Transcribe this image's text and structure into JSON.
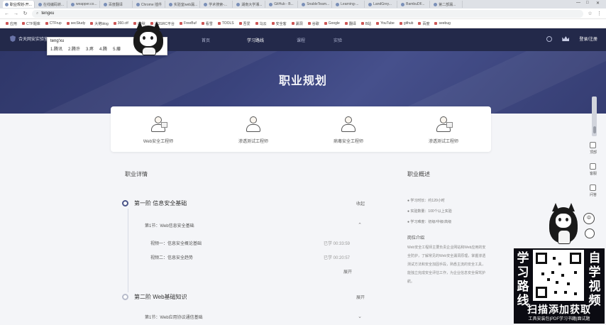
{
  "browser": {
    "tabs": [
      {
        "title": "职业规划-开...",
        "active": true
      },
      {
        "title": "在线编码转..."
      },
      {
        "title": "weapper.co..."
      },
      {
        "title": "百度翻译"
      },
      {
        "title": "Chrome 插件"
      },
      {
        "title": "实验室web漏..."
      },
      {
        "title": "学术搜索-..."
      },
      {
        "title": "湖南大学湘..."
      },
      {
        "title": "GitHub - B..."
      },
      {
        "title": "SnableTeam..."
      },
      {
        "title": "Learning-..."
      },
      {
        "title": "LandGrey..."
      },
      {
        "title": "BambuDF..."
      },
      {
        "title": "第二部漏..."
      }
    ],
    "address": "tengxu",
    "bookmarks": [
      "应用",
      "CTF题库",
      "CTFrup",
      "secStudy",
      "大佬blog",
      "360.ctf",
      "i春秋",
      "X 3SRC平台",
      "FreeBuf",
      "看雪",
      "TOOLS",
      "吾爱",
      "乌云",
      "安全客",
      "漏洞",
      "谷歌",
      "Google",
      "翻译",
      "B站",
      "YouTube",
      "github",
      "百度",
      "seebug"
    ]
  },
  "suggest": {
    "typed": "teng'xu",
    "candidates": [
      "1.腾讯",
      "2.腾许",
      "3.疼",
      "4.腾",
      "5.藤"
    ]
  },
  "site": {
    "logo_text": "合天网安实验室",
    "nav": [
      "首页",
      "学习路线",
      "课程",
      "实验"
    ],
    "active_nav": "学习路线",
    "login_label": "登录/注册"
  },
  "banner": {
    "title": "职业规划"
  },
  "cards": [
    {
      "label": "Web安全工程师",
      "icon": "engineer-icon"
    },
    {
      "label": "渗透测试工程师",
      "icon": "pentester-icon"
    },
    {
      "label": "病毒安全工程师",
      "icon": "analyst-icon"
    },
    {
      "label": "渗透测试工程师",
      "icon": "tester-icon"
    }
  ],
  "details": {
    "section_title": "职业详情",
    "stages": [
      {
        "name": "第一阶 信息安全基础",
        "toggle": "收起",
        "lesson": "第1节：Web信息安全基础",
        "videos": [
          {
            "title": "视频一：信息安全概论基础",
            "meta": "已学  00:33:59"
          },
          {
            "title": "视频二：信息安全趋势",
            "meta": "已学  00:20:57"
          }
        ],
        "more": "展开"
      },
      {
        "name": "第二阶 Web基础知识",
        "toggle": "展开",
        "lesson": "第1节：Web应用协议通信基础"
      }
    ]
  },
  "overview": {
    "section_title": "职业概述",
    "rows": [
      "● 学习时长：约120小时",
      "● 实验数量：100个以上实验",
      "● 学习难度：初级/中级/高级"
    ],
    "para_title": "岗位介绍",
    "para": "Web安全工程师主要负责企业网站和Web应用的安全防护，了解常见的Web安全漏洞原理，掌握渗透测试方法和安全加固手段，熟悉主流的安全工具，能独立完成安全评估工作，为企业信息安全保驾护航。"
  },
  "floatbar": [
    "顶部",
    "客服",
    "问答"
  ],
  "promo": {
    "left": [
      "学",
      "习",
      "路",
      "线"
    ],
    "right": [
      "自",
      "学",
      "视",
      "频"
    ],
    "cta": "扫描添加获取",
    "sub": "工具安装包|PDF学习书籍|面试题"
  }
}
